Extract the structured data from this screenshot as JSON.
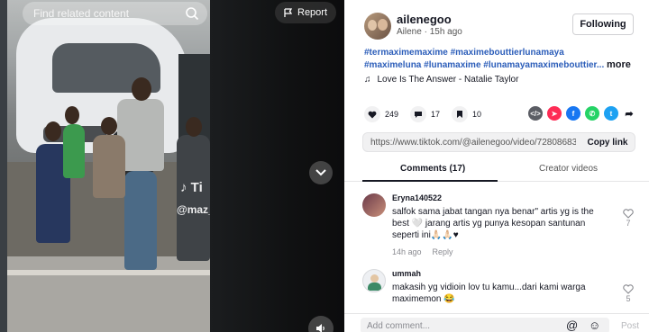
{
  "video": {
    "search_placeholder": "Find related content",
    "report_label": "Report",
    "watermark": "Ti",
    "watermark_user": "@maz_i"
  },
  "author": {
    "username": "ailenegoo",
    "display_name": "Ailene",
    "time_ago": "15h ago",
    "follow_label": "Following"
  },
  "description": {
    "hashtags": "#termaximemaxime #maximebouttierlunamaya #maximeluna #lunamaxime #lunamayamaximebouttier...",
    "more_label": "more",
    "music": "Love Is The Answer - Natalie Taylor"
  },
  "actions": {
    "likes": "249",
    "comments": "17",
    "saves": "10"
  },
  "share": {
    "link": "https://www.tiktok.com/@ailenegoo/video/72808683...",
    "copy_label": "Copy link"
  },
  "tabs": [
    {
      "label": "Comments (17)"
    },
    {
      "label": "Creator videos"
    }
  ],
  "comments": [
    {
      "user": "Eryna140522",
      "text": "salfok sama jabat tangan nya benar\" artis yg is the best 🤍 jarang artis yg punya kesopan santunan seperti ini🙏🏻🙏🏻♥",
      "time": "14h ago",
      "reply_label": "Reply",
      "likes": "7"
    },
    {
      "user": "ummah",
      "text": "makasih yg vidioin lov tu kamu...dari kami warga maximemon 😂",
      "likes": "5"
    }
  ],
  "add_comment": {
    "placeholder": "Add comment...",
    "post_label": "Post"
  },
  "colors": {
    "hashtag": "#2b5db9",
    "text": "#161823",
    "muted": "#8a8b91"
  }
}
